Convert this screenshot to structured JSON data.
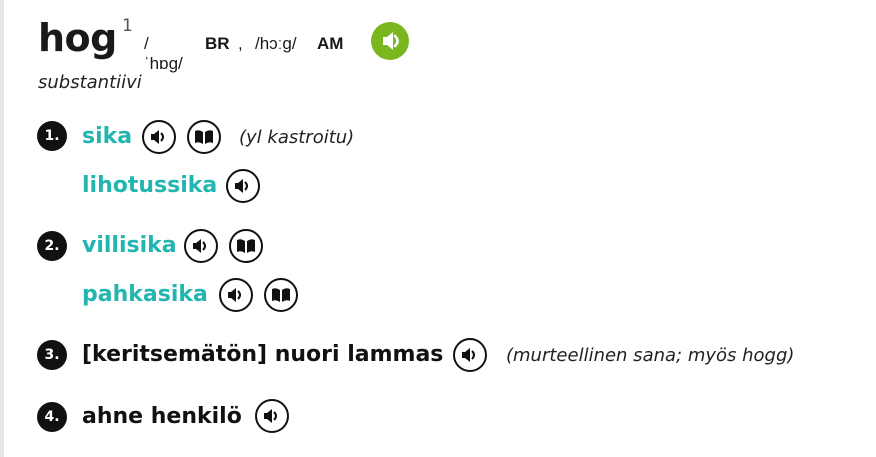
{
  "entry": {
    "headword": "hog",
    "homograph": "1",
    "pron_br": "/ˈhɒɡ/",
    "label_br": "BR",
    "comma": ",",
    "pron_am": "/hɔːɡ/",
    "label_am": "AM",
    "part_of_speech": "substantiivi"
  },
  "senses": [
    {
      "number": "1.",
      "translations": [
        "sika",
        "lihotussika"
      ],
      "note": "(yl kastroitu)"
    },
    {
      "number": "2.",
      "translations": [
        "villisika",
        "pahkasika"
      ]
    },
    {
      "number": "3.",
      "translations": [
        "[keritsemätön] nuori lammas"
      ],
      "note": "(murteellinen sana; myös hogg)"
    },
    {
      "number": "4.",
      "translations": [
        "ahne henkilö"
      ]
    }
  ],
  "colors": {
    "accent": "#7ab61d",
    "link": "#23b6b0",
    "text": "#111111"
  },
  "icons": {
    "audio": "speaker-icon",
    "dictionary": "book-icon"
  }
}
